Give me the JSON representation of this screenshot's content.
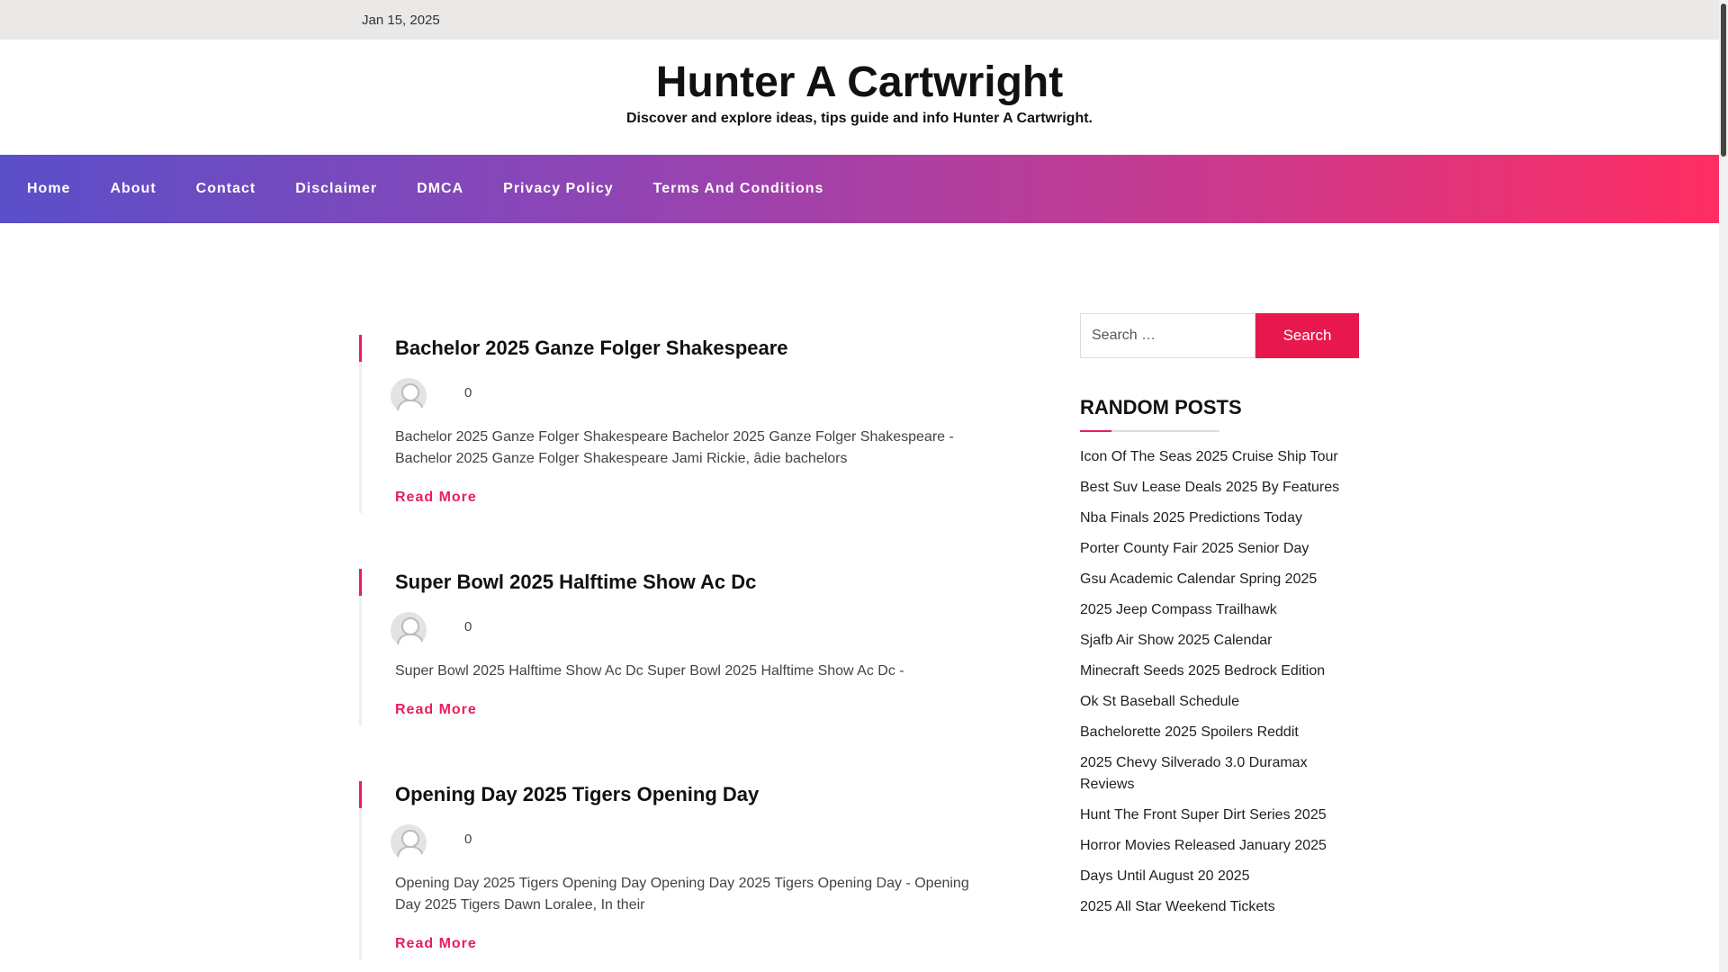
{
  "topbar": {
    "date": "Jan 15, 2025"
  },
  "header": {
    "title": "Hunter A Cartwright",
    "description": "Discover and explore ideas, tips guide and info Hunter A Cartwright."
  },
  "nav": {
    "items": [
      "Home",
      "About",
      "Contact",
      "Disclaimer",
      "DMCA",
      "Privacy Policy",
      "Terms And Conditions"
    ]
  },
  "posts": [
    {
      "title": "Bachelor 2025 Ganze Folger Shakespeare",
      "comments": "0",
      "excerpt": "Bachelor 2025 Ganze Folger Shakespeare Bachelor 2025 Ganze Folger Shakespeare - Bachelor 2025 Ganze Folger Shakespeare Jami Rickie, âdie bachelors",
      "read_more": "Read More"
    },
    {
      "title": "Super Bowl 2025 Halftime Show Ac Dc",
      "comments": "0",
      "excerpt": "Super Bowl 2025 Halftime Show Ac Dc Super Bowl 2025 Halftime Show Ac Dc -",
      "read_more": "Read More"
    },
    {
      "title": "Opening Day 2025 Tigers Opening Day",
      "comments": "0",
      "excerpt": "Opening Day 2025 Tigers Opening Day Opening Day 2025 Tigers Opening Day - Opening Day 2025 Tigers Dawn Loralee, In their",
      "read_more": "Read More"
    }
  ],
  "sidebar": {
    "search": {
      "placeholder": "Search …",
      "button": "Search"
    },
    "random_title": "RANDOM POSTS",
    "random_posts": [
      "Icon Of The Seas 2025 Cruise Ship Tour",
      "Best Suv Lease Deals 2025 By Features",
      "Nba Finals 2025 Predictions Today",
      "Porter County Fair 2025 Senior Day",
      "Gsu Academic Calendar Spring 2025",
      "2025 Jeep Compass Trailhawk",
      "Sjafb Air Show 2025 Calendar",
      "Minecraft Seeds 2025 Bedrock Edition",
      "Ok St Baseball Schedule",
      "Bachelorette 2025 Spoilers Reddit",
      "2025 Chevy Silverado 3.0 Duramax Reviews",
      "Hunt The Front Super Dirt Series 2025",
      "Horror Movies Released January 2025",
      "Days Until August 20 2025",
      "2025 All Star Weekend Tickets"
    ]
  },
  "colors": {
    "accent": "#e91e5a",
    "nav_start": "#5a4fc9",
    "nav_end": "#ff2d63"
  }
}
